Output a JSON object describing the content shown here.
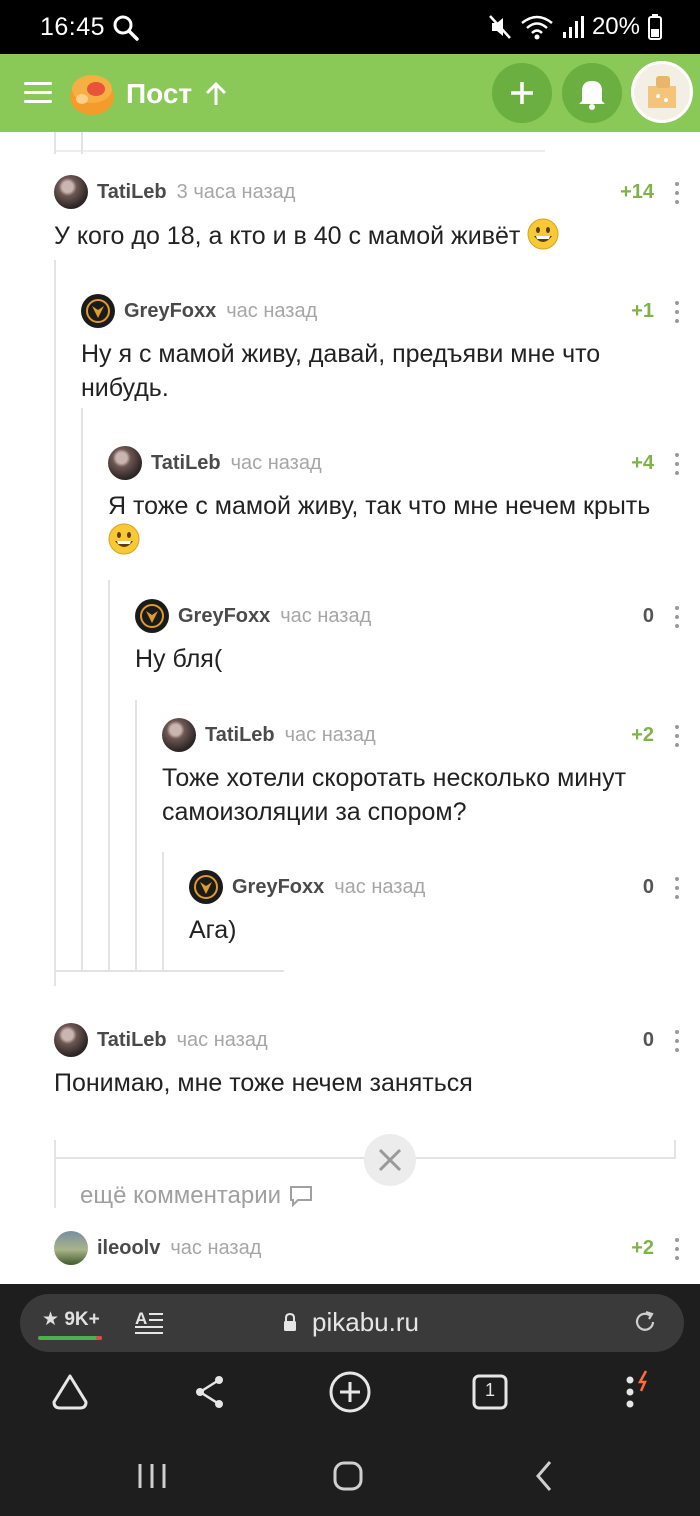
{
  "status_bar": {
    "time": "16:45",
    "battery": "20%"
  },
  "header": {
    "title": "Пост"
  },
  "comments": [
    {
      "author": "TatiLeb",
      "time": "3 часа назад",
      "rating": "+14",
      "text": "У кого до 18, а кто и в 40 с мамой живёт",
      "emoji": true
    },
    {
      "author": "GreyFoxx",
      "time": "час назад",
      "rating": "+1",
      "text": "Ну я с мамой живу, давай, предъяви мне что нибудь."
    },
    {
      "author": "TatiLeb",
      "time": "час назад",
      "rating": "+4",
      "text": "Я тоже с мамой живу, так что мне нечем крыть",
      "emoji": true
    },
    {
      "author": "GreyFoxx",
      "time": "час назад",
      "rating": "0",
      "text": "Ну бля("
    },
    {
      "author": "TatiLeb",
      "time": "час назад",
      "rating": "+2",
      "text": "Тоже хотели скоротать несколько минут самоизоляции за спором?"
    },
    {
      "author": "GreyFoxx",
      "time": "час назад",
      "rating": "0",
      "text": "Ага)"
    },
    {
      "author": "TatiLeb",
      "time": "час назад",
      "rating": "0",
      "text": "Понимаю, мне тоже нечем заняться"
    },
    {
      "author": "ileoolv",
      "time": "час назад",
      "rating": "+2",
      "text": ""
    }
  ],
  "more_comments_label": "ещё комментарии",
  "browser": {
    "badge": "9K+",
    "url": "pikabu.ru",
    "tab_count": "1"
  },
  "colors": {
    "brand_green": "#8ac858",
    "rating_green": "#7fb34a"
  }
}
